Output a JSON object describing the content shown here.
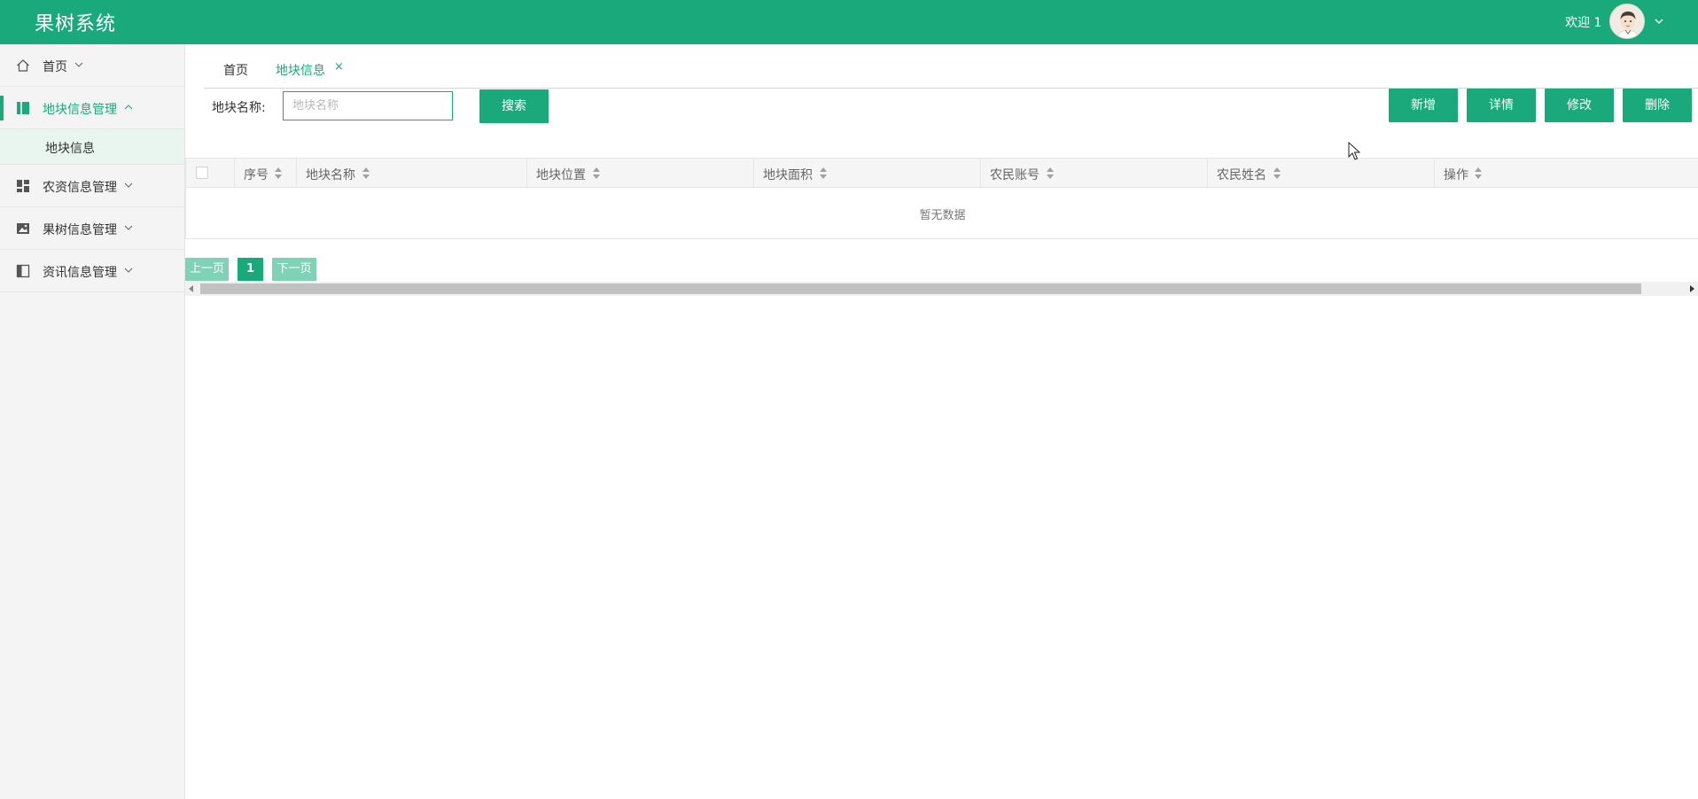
{
  "app": {
    "title": "果树系统"
  },
  "user": {
    "welcome": "欢迎 1"
  },
  "sidebar": {
    "items": [
      {
        "label": "首页"
      },
      {
        "label": "地块信息管理",
        "children": [
          {
            "label": "地块信息"
          }
        ]
      },
      {
        "label": "农资信息管理"
      },
      {
        "label": "果树信息管理"
      },
      {
        "label": "资讯信息管理"
      }
    ]
  },
  "tabs": [
    {
      "label": "首页"
    },
    {
      "label": "地块信息",
      "close": "×"
    }
  ],
  "search": {
    "label": "地块名称:",
    "placeholder": "地块名称",
    "value": "",
    "button": "搜索"
  },
  "toolbar": {
    "add": "新增",
    "detail": "详情",
    "edit": "修改",
    "delete": "删除"
  },
  "table": {
    "columns": [
      "序号",
      "地块名称",
      "地块位置",
      "地块面积",
      "农民账号",
      "农民姓名",
      "操作"
    ],
    "rows": [],
    "empty_text": "暂无数据"
  },
  "pagination": {
    "prev": "上一页",
    "current": "1",
    "next": "下一页"
  },
  "colors": {
    "primary": "#1aa97a",
    "light": "#7fd2b5"
  }
}
